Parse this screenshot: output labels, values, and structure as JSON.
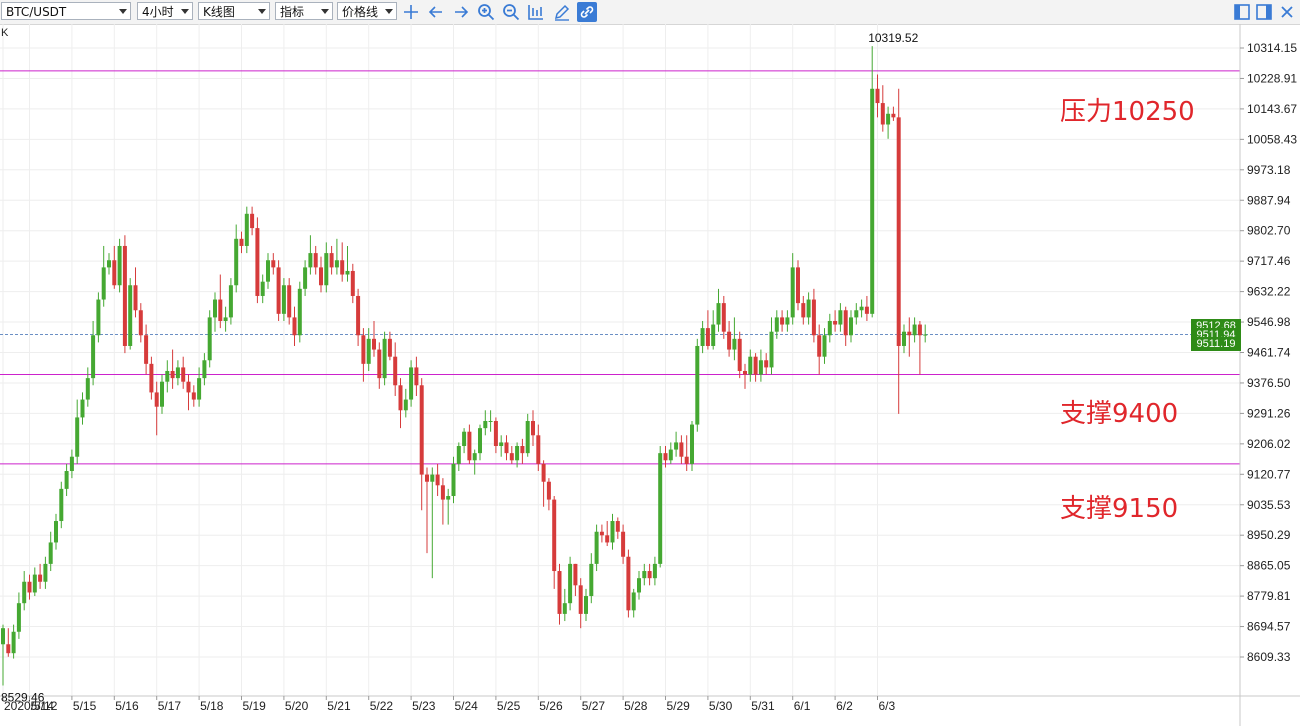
{
  "toolbar": {
    "symbol": "BTC/USDT",
    "interval": "4小时",
    "chart_type": "K线图",
    "indicator": "指标",
    "price_line": "价格线",
    "icons": [
      "crosshair-icon",
      "arrow-left-icon",
      "arrow-right-icon",
      "zoom-in-icon",
      "zoom-out-icon",
      "chart-mode-icon",
      "pencil-icon",
      "link-icon",
      "panel-left-icon",
      "panel-right-icon",
      "close-icon"
    ]
  },
  "chart_data": {
    "type": "candlestick",
    "series_label": "K",
    "y_ticks": [
      "10314.15",
      "10228.91",
      "10143.67",
      "10058.43",
      "9973.18",
      "9887.94",
      "9802.70",
      "9717.46",
      "9632.22",
      "9546.98",
      "9461.74",
      "9376.50",
      "9291.26",
      "9206.02",
      "9120.77",
      "9035.53",
      "8950.29",
      "8865.05",
      "8779.81",
      "8694.57",
      "8609.33"
    ],
    "x_ticks": [
      "2020/5/12",
      "5/14",
      "5/15",
      "5/16",
      "5/17",
      "5/18",
      "5/19",
      "5/20",
      "5/21",
      "5/22",
      "5/23",
      "5/24",
      "5/25",
      "5/26",
      "5/27",
      "5/28",
      "5/29",
      "5/30",
      "5/31",
      "6/1",
      "6/2",
      "6/3"
    ],
    "high_label": "10319.52",
    "low_label": "8529.46",
    "price_tags": [
      "9512.68",
      "9511.94",
      "9511.19"
    ],
    "current_price": 9512,
    "levels": [
      10250,
      9400,
      9150
    ],
    "annotations": [
      "压力10250",
      "支撑9400",
      "支撑9150"
    ],
    "colors": {
      "up": "#45a832",
      "down": "#d63b3b",
      "level": "#cc22cc",
      "current": "#6b8fc4",
      "tag": "#2e8b17"
    },
    "candles": [
      [
        0,
        8645,
        8690,
        8529.46,
        8700
      ],
      [
        1,
        8645,
        8620,
        8610,
        8690
      ],
      [
        2,
        8620,
        8680,
        8605,
        8700
      ],
      [
        3,
        8680,
        8760,
        8660,
        8790
      ],
      [
        4,
        8760,
        8820,
        8740,
        8850
      ],
      [
        5,
        8820,
        8790,
        8770,
        8840
      ],
      [
        6,
        8790,
        8840,
        8780,
        8860
      ],
      [
        7,
        8840,
        8820,
        8800,
        8870
      ],
      [
        8,
        8820,
        8870,
        8800,
        8890
      ],
      [
        9,
        8870,
        8930,
        8850,
        8960
      ],
      [
        10,
        8930,
        8990,
        8910,
        9010
      ],
      [
        11,
        8990,
        9080,
        8970,
        9100
      ],
      [
        12,
        9080,
        9130,
        9060,
        9150
      ],
      [
        13,
        9130,
        9170,
        9110,
        9190
      ],
      [
        14,
        9170,
        9280,
        9150,
        9330
      ],
      [
        15,
        9280,
        9330,
        9260,
        9350
      ],
      [
        16,
        9330,
        9390,
        9310,
        9420
      ],
      [
        17,
        9390,
        9510,
        9370,
        9550
      ],
      [
        18,
        9510,
        9610,
        9490,
        9630
      ],
      [
        19,
        9610,
        9700,
        9590,
        9760
      ],
      [
        20,
        9700,
        9720,
        9680,
        9740
      ],
      [
        21,
        9720,
        9650,
        9640,
        9760
      ],
      [
        22,
        9650,
        9760,
        9630,
        9780
      ],
      [
        23,
        9760,
        9480,
        9460,
        9790
      ],
      [
        24,
        9480,
        9650,
        9470,
        9670
      ],
      [
        25,
        9650,
        9580,
        9560,
        9700
      ],
      [
        26,
        9580,
        9510,
        9490,
        9600
      ],
      [
        27,
        9510,
        9430,
        9400,
        9540
      ],
      [
        28,
        9430,
        9350,
        9330,
        9450
      ],
      [
        29,
        9350,
        9310,
        9230,
        9380
      ],
      [
        30,
        9310,
        9380,
        9290,
        9400
      ],
      [
        31,
        9380,
        9410,
        9350,
        9440
      ],
      [
        32,
        9410,
        9390,
        9360,
        9470
      ],
      [
        33,
        9390,
        9420,
        9370,
        9440
      ],
      [
        34,
        9420,
        9380,
        9360,
        9450
      ],
      [
        35,
        9380,
        9350,
        9300,
        9400
      ],
      [
        36,
        9350,
        9330,
        9310,
        9370
      ],
      [
        37,
        9330,
        9390,
        9310,
        9420
      ],
      [
        38,
        9390,
        9440,
        9370,
        9460
      ],
      [
        39,
        9440,
        9560,
        9420,
        9580
      ],
      [
        40,
        9560,
        9610,
        9520,
        9630
      ],
      [
        41,
        9610,
        9550,
        9530,
        9680
      ],
      [
        42,
        9550,
        9560,
        9520,
        9590
      ],
      [
        43,
        9560,
        9650,
        9540,
        9670
      ],
      [
        44,
        9650,
        9780,
        9630,
        9820
      ],
      [
        45,
        9780,
        9760,
        9740,
        9800
      ],
      [
        46,
        9760,
        9850,
        9740,
        9870
      ],
      [
        47,
        9850,
        9810,
        9790,
        9870
      ],
      [
        48,
        9810,
        9620,
        9600,
        9840
      ],
      [
        49,
        9620,
        9660,
        9600,
        9680
      ],
      [
        50,
        9660,
        9720,
        9640,
        9740
      ],
      [
        51,
        9720,
        9700,
        9680,
        9740
      ],
      [
        52,
        9700,
        9570,
        9550,
        9720
      ],
      [
        53,
        9570,
        9650,
        9550,
        9670
      ],
      [
        54,
        9650,
        9560,
        9540,
        9670
      ],
      [
        55,
        9560,
        9510,
        9480,
        9590
      ],
      [
        56,
        9510,
        9640,
        9490,
        9660
      ],
      [
        57,
        9640,
        9700,
        9620,
        9720
      ],
      [
        58,
        9700,
        9740,
        9680,
        9790
      ],
      [
        59,
        9740,
        9700,
        9680,
        9760
      ],
      [
        60,
        9700,
        9650,
        9630,
        9730
      ],
      [
        61,
        9650,
        9740,
        9630,
        9770
      ],
      [
        62,
        9740,
        9700,
        9680,
        9760
      ],
      [
        63,
        9700,
        9720,
        9680,
        9780
      ],
      [
        64,
        9720,
        9680,
        9660,
        9770
      ],
      [
        65,
        9680,
        9690,
        9660,
        9760
      ],
      [
        66,
        9690,
        9620,
        9600,
        9710
      ],
      [
        67,
        9620,
        9510,
        9480,
        9640
      ],
      [
        68,
        9510,
        9430,
        9380,
        9530
      ],
      [
        69,
        9430,
        9500,
        9410,
        9530
      ],
      [
        70,
        9500,
        9470,
        9450,
        9550
      ],
      [
        71,
        9470,
        9390,
        9360,
        9490
      ],
      [
        72,
        9390,
        9500,
        9370,
        9520
      ],
      [
        73,
        9500,
        9450,
        9440,
        9520
      ],
      [
        74,
        9450,
        9370,
        9340,
        9490
      ],
      [
        75,
        9370,
        9300,
        9250,
        9390
      ],
      [
        76,
        9300,
        9330,
        9280,
        9360
      ],
      [
        77,
        9330,
        9420,
        9310,
        9440
      ],
      [
        78,
        9420,
        9370,
        9340,
        9450
      ],
      [
        79,
        9370,
        9120,
        9020,
        9390
      ],
      [
        80,
        9120,
        9100,
        8900,
        9140
      ],
      [
        81,
        9100,
        9120,
        8830,
        9140
      ],
      [
        82,
        9120,
        9090,
        9060,
        9150
      ],
      [
        83,
        9090,
        9050,
        8980,
        9110
      ],
      [
        84,
        9050,
        9060,
        8980,
        9080
      ],
      [
        85,
        9060,
        9150,
        9040,
        9170
      ],
      [
        86,
        9150,
        9200,
        9130,
        9210
      ],
      [
        87,
        9200,
        9240,
        9180,
        9250
      ],
      [
        88,
        9240,
        9160,
        9150,
        9260
      ],
      [
        89,
        9160,
        9180,
        9120,
        9190
      ],
      [
        90,
        9180,
        9250,
        9160,
        9260
      ],
      [
        91,
        9250,
        9270,
        9230,
        9300
      ],
      [
        92,
        9270,
        9270,
        9240,
        9300
      ],
      [
        93,
        9270,
        9200,
        9180,
        9280
      ],
      [
        94,
        9200,
        9210,
        9170,
        9230
      ],
      [
        95,
        9210,
        9180,
        9160,
        9230
      ],
      [
        96,
        9180,
        9160,
        9150,
        9200
      ],
      [
        97,
        9160,
        9200,
        9140,
        9210
      ],
      [
        98,
        9200,
        9180,
        9150,
        9220
      ],
      [
        99,
        9180,
        9270,
        9170,
        9290
      ],
      [
        100,
        9270,
        9230,
        9200,
        9300
      ],
      [
        101,
        9230,
        9150,
        9130,
        9260
      ],
      [
        102,
        9150,
        9100,
        9030,
        9160
      ],
      [
        103,
        9100,
        9050,
        9020,
        9110
      ],
      [
        104,
        9050,
        8850,
        8800,
        9060
      ],
      [
        105,
        8850,
        8730,
        8700,
        8870
      ],
      [
        106,
        8730,
        8760,
        8710,
        8800
      ],
      [
        107,
        8760,
        8870,
        8740,
        8890
      ],
      [
        108,
        8870,
        8810,
        8780,
        8870
      ],
      [
        109,
        8810,
        8730,
        8690,
        8830
      ],
      [
        110,
        8730,
        8780,
        8710,
        8800
      ],
      [
        111,
        8780,
        8870,
        8760,
        8900
      ],
      [
        112,
        8870,
        8960,
        8850,
        8980
      ],
      [
        113,
        8960,
        8950,
        8930,
        8980
      ],
      [
        114,
        8950,
        8930,
        8920,
        8990
      ],
      [
        115,
        8930,
        8990,
        8910,
        9010
      ],
      [
        116,
        8990,
        8960,
        8940,
        9000
      ],
      [
        117,
        8960,
        8890,
        8870,
        8980
      ],
      [
        118,
        8890,
        8740,
        8720,
        8910
      ],
      [
        119,
        8740,
        8790,
        8720,
        8800
      ],
      [
        120,
        8790,
        8830,
        8770,
        8850
      ],
      [
        121,
        8830,
        8850,
        8810,
        8870
      ],
      [
        122,
        8850,
        8830,
        8810,
        8870
      ],
      [
        123,
        8830,
        8870,
        8810,
        8890
      ],
      [
        124,
        8870,
        9180,
        8860,
        9200
      ],
      [
        125,
        9180,
        9160,
        9140,
        9200
      ],
      [
        126,
        9160,
        9190,
        9150,
        9210
      ],
      [
        127,
        9190,
        9210,
        9170,
        9240
      ],
      [
        128,
        9210,
        9170,
        9150,
        9230
      ],
      [
        129,
        9170,
        9150,
        9130,
        9230
      ],
      [
        130,
        9150,
        9260,
        9130,
        9270
      ],
      [
        131,
        9260,
        9480,
        9240,
        9500
      ],
      [
        132,
        9480,
        9530,
        9460,
        9550
      ],
      [
        133,
        9530,
        9480,
        9470,
        9580
      ],
      [
        134,
        9480,
        9540,
        9470,
        9580
      ],
      [
        135,
        9540,
        9600,
        9520,
        9640
      ],
      [
        136,
        9600,
        9520,
        9500,
        9620
      ],
      [
        137,
        9520,
        9470,
        9450,
        9550
      ],
      [
        138,
        9470,
        9500,
        9440,
        9560
      ],
      [
        139,
        9500,
        9410,
        9390,
        9520
      ],
      [
        140,
        9410,
        9400,
        9360,
        9430
      ],
      [
        141,
        9400,
        9450,
        9380,
        9470
      ],
      [
        142,
        9450,
        9400,
        9380,
        9460
      ],
      [
        143,
        9400,
        9440,
        9380,
        9470
      ],
      [
        144,
        9440,
        9420,
        9400,
        9460
      ],
      [
        145,
        9420,
        9520,
        9400,
        9560
      ],
      [
        146,
        9520,
        9560,
        9500,
        9580
      ],
      [
        147,
        9560,
        9540,
        9520,
        9580
      ],
      [
        148,
        9540,
        9560,
        9520,
        9580
      ],
      [
        149,
        9560,
        9700,
        9540,
        9740
      ],
      [
        150,
        9700,
        9600,
        9580,
        9720
      ],
      [
        151,
        9600,
        9560,
        9540,
        9620
      ],
      [
        152,
        9560,
        9610,
        9540,
        9630
      ],
      [
        153,
        9610,
        9510,
        9490,
        9640
      ],
      [
        154,
        9510,
        9450,
        9400,
        9540
      ],
      [
        155,
        9450,
        9510,
        9430,
        9530
      ],
      [
        156,
        9510,
        9550,
        9490,
        9570
      ],
      [
        157,
        9550,
        9540,
        9520,
        9580
      ],
      [
        158,
        9540,
        9580,
        9520,
        9600
      ],
      [
        159,
        9580,
        9510,
        9480,
        9590
      ],
      [
        160,
        9510,
        9560,
        9490,
        9580
      ],
      [
        161,
        9560,
        9580,
        9540,
        9600
      ],
      [
        162,
        9580,
        9590,
        9560,
        9610
      ],
      [
        163,
        9590,
        9570,
        9550,
        9620
      ],
      [
        164,
        9570,
        10200,
        9560,
        10319.52
      ],
      [
        165,
        10200,
        10160,
        10120,
        10240
      ],
      [
        166,
        10160,
        10100,
        10080,
        10210
      ],
      [
        167,
        10100,
        10130,
        10060,
        10150
      ],
      [
        168,
        10130,
        10120,
        10110,
        10150
      ],
      [
        169,
        10120,
        9480,
        9290,
        10200
      ],
      [
        170,
        9480,
        9520,
        9460,
        9540
      ],
      [
        171,
        9520,
        9510,
        9450,
        9560
      ],
      [
        172,
        9510,
        9540,
        9490,
        9560
      ],
      [
        173,
        9540,
        9510,
        9400,
        9550
      ],
      [
        174,
        9510,
        9512,
        9490,
        9540
      ]
    ]
  }
}
